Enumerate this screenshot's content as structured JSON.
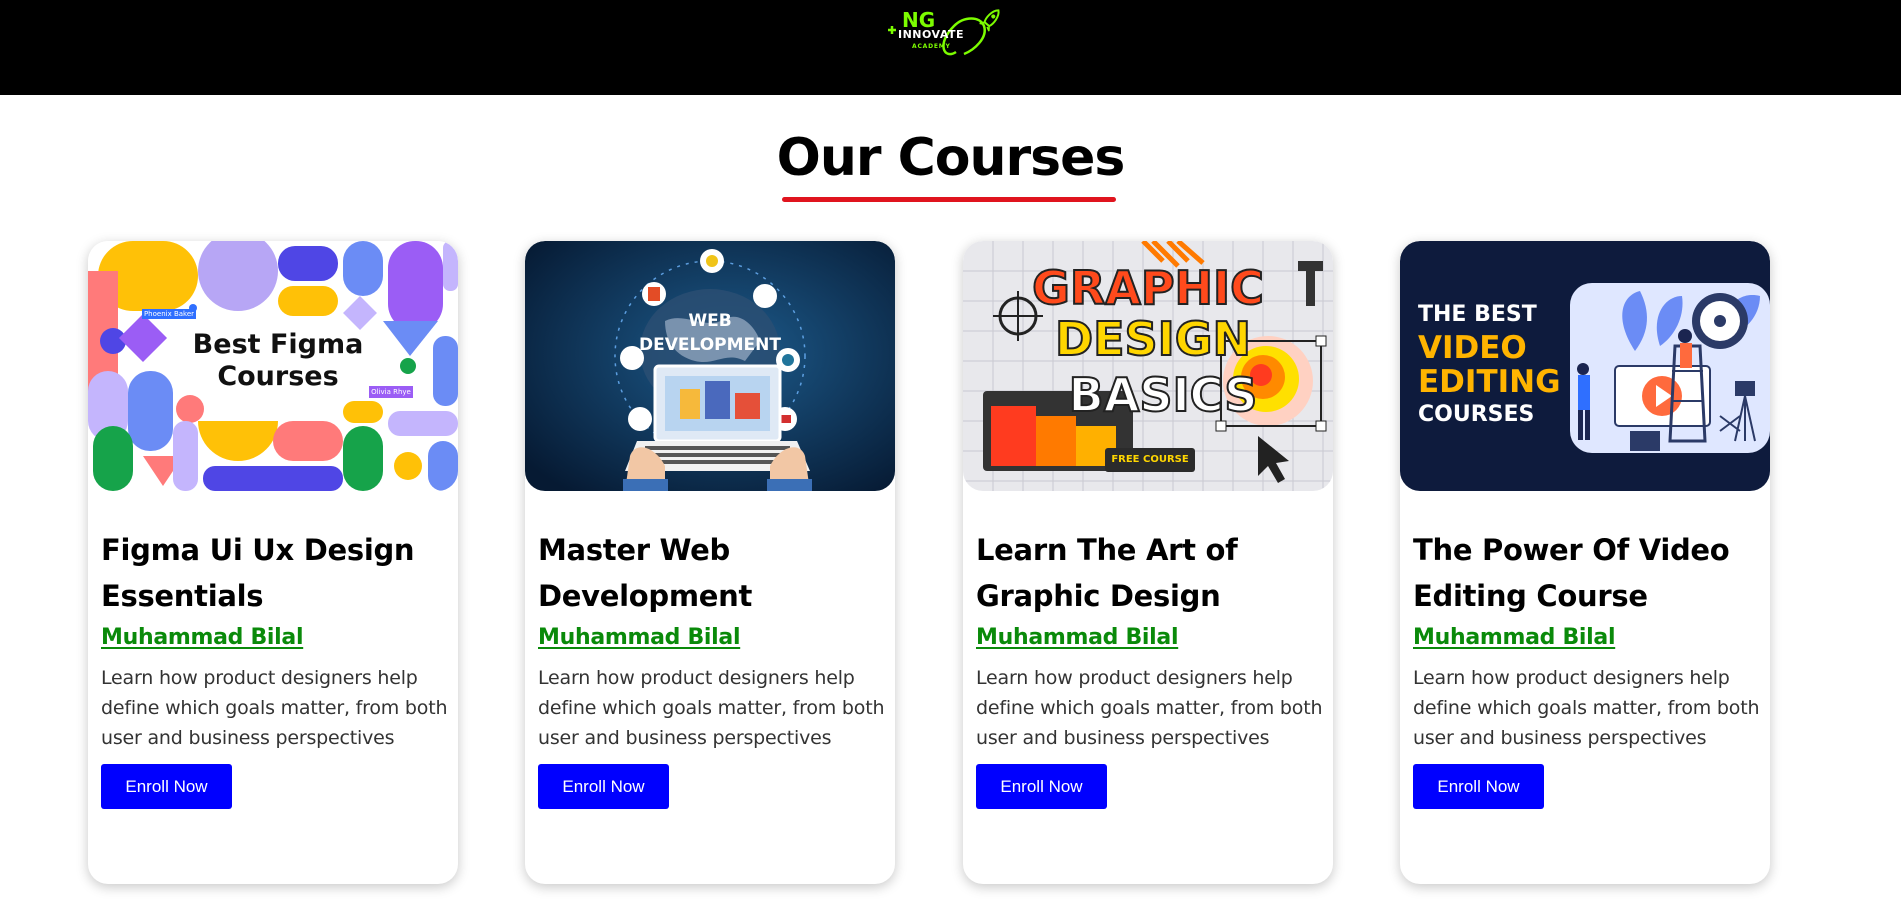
{
  "header": {
    "logo": {
      "ng": "NG",
      "innovate": "INNOVATE",
      "academy": "ACADEMY"
    }
  },
  "section": {
    "title": "Our Courses",
    "underline_color": "#e0141e"
  },
  "colors": {
    "topbar": "#000000",
    "instructor": "#0a8a0a",
    "button": "#0000ff",
    "button_text": "#ffffff"
  },
  "courses": [
    {
      "thumbnail_text": [
        "Best Figma",
        "Courses"
      ],
      "thumbnail_tags": [
        "Phoenix Baker",
        "Olivia Rhye"
      ],
      "title": "Figma Ui Ux Design Essentials",
      "instructor": "Muhammad Bilal",
      "description": "Learn how product designers help define which goals matter, from both user and business perspectives",
      "button_label": "Enroll Now"
    },
    {
      "thumbnail_text": [
        "WEB",
        "DEVELOPMENT"
      ],
      "title": "Master Web Development",
      "instructor": "Muhammad Bilal",
      "description": "Learn how product designers help define which goals matter, from both user and business perspectives",
      "button_label": "Enroll Now"
    },
    {
      "thumbnail_text": [
        "GRAPHIC",
        "DESIGN",
        "BASICS",
        "FREE COURSE"
      ],
      "title": "Learn The Art of Graphic Design",
      "instructor": "Muhammad Bilal",
      "description": "Learn how product designers help define which goals matter, from both user and business perspectives",
      "button_label": "Enroll Now"
    },
    {
      "thumbnail_text": [
        "THE BEST",
        "VIDEO",
        "EDITING",
        "COURSES"
      ],
      "title": "The Power Of Video Editing Course",
      "instructor": "Muhammad Bilal",
      "description": "Learn how product designers help define which goals matter, from both user and business perspectives",
      "button_label": "Enroll Now"
    }
  ]
}
